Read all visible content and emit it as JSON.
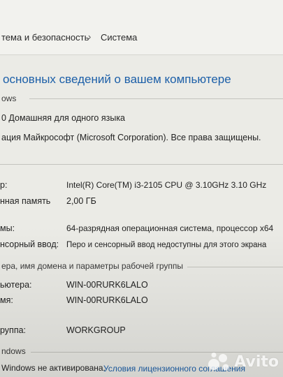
{
  "breadcrumb": {
    "item1": "тема и безопасность",
    "separator": "›",
    "item2": "Система"
  },
  "heading": "основных сведений о вашем компьютере",
  "edition": {
    "section_title": "ows",
    "name": "0 Домашняя для одного языка",
    "copyright": "ация Майкрософт (Microsoft Corporation). Все права защищены."
  },
  "system": {
    "rows": [
      {
        "label": "р:",
        "value": "Intel(R) Core(TM) i3-2105 CPU @ 3.10GHz   3.10 GHz"
      },
      {
        "label": "нная память",
        "value": "2,00 ГБ"
      },
      {
        "label": "мы:",
        "value": "64-разрядная операционная система, процессор x64"
      },
      {
        "label": "нсорный ввод:",
        "value": "Перо и сенсорный ввод недоступны для этого экрана"
      }
    ]
  },
  "computer": {
    "section_title": "ера, имя домена и параметры рабочей группы",
    "rows": [
      {
        "label": "ьютера:",
        "value": "WIN-00RURK6LALO"
      },
      {
        "label": "мя:",
        "value": "WIN-00RURK6LALO"
      },
      {
        "label": "руппа:",
        "value": "WORKGROUP"
      }
    ]
  },
  "activation": {
    "section_title": "ndows",
    "status": "Windows не активирована.",
    "license_link": "Условия лицензионного соглашения"
  },
  "watermark": {
    "brand": "Avito",
    "icon": "avito-logo-icon"
  }
}
